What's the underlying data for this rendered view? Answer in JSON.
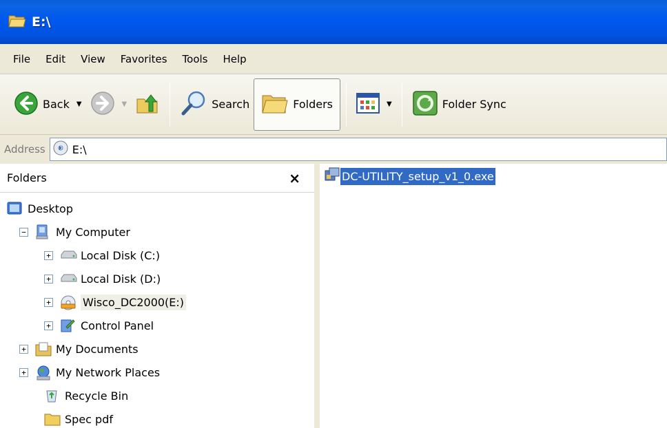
{
  "window": {
    "title": "E:\\"
  },
  "menu": [
    "File",
    "Edit",
    "View",
    "Favorites",
    "Tools",
    "Help"
  ],
  "toolbar": {
    "back": "Back",
    "search": "Search",
    "folders": "Folders",
    "folder_sync": "Folder Sync"
  },
  "address": {
    "label": "Address",
    "value": "E:\\"
  },
  "folders_pane": {
    "title": "Folders",
    "close": "×",
    "tree": [
      {
        "label": "Desktop"
      },
      {
        "label": "My Computer",
        "expander": "−"
      },
      {
        "label": "Local Disk (C:)",
        "expander": "+"
      },
      {
        "label": "Local Disk (D:)",
        "expander": "+"
      },
      {
        "label": "Wisco_DC2000(E:)",
        "expander": "+"
      },
      {
        "label": "Control Panel",
        "expander": "+"
      },
      {
        "label": "My Documents",
        "expander": "+"
      },
      {
        "label": "My Network Places",
        "expander": "+"
      },
      {
        "label": "Recycle Bin"
      },
      {
        "label": "Spec pdf"
      }
    ]
  },
  "files": [
    {
      "name": "DC-UTILITY_setup_v1_0.exe"
    }
  ],
  "colors": {
    "title_bar": "#0058ee",
    "selection": "#316ac5"
  }
}
